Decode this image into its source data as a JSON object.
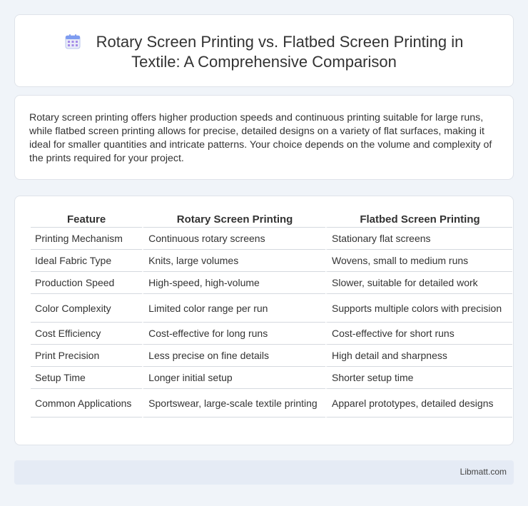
{
  "header": {
    "icon": "calendar-icon",
    "title": "Rotary Screen Printing vs. Flatbed Screen Printing in Textile: A Comprehensive Comparison"
  },
  "intro": {
    "text": "Rotary screen printing offers higher production speeds and continuous printing suitable for large runs, while flatbed screen printing allows for precise, detailed designs on a variety of flat surfaces, making it ideal for smaller quantities and intricate patterns. Your choice depends on the volume and complexity of the prints required for your project."
  },
  "table": {
    "headers": [
      "Feature",
      "Rotary Screen Printing",
      "Flatbed Screen Printing"
    ],
    "rows": [
      [
        "Printing Mechanism",
        "Continuous rotary screens",
        "Stationary flat screens"
      ],
      [
        "Ideal Fabric Type",
        "Knits, large volumes",
        "Wovens, small to medium runs"
      ],
      [
        "Production Speed",
        "High-speed, high-volume",
        "Slower, suitable for detailed work"
      ],
      [
        "Color Complexity",
        "Limited color range per run",
        "Supports multiple colors with precision"
      ],
      [
        "Cost Efficiency",
        "Cost-effective for long runs",
        "Cost-effective for short runs"
      ],
      [
        "Print Precision",
        "Less precise on fine details",
        "High detail and sharpness"
      ],
      [
        "Setup Time",
        "Longer initial setup",
        "Shorter setup time"
      ],
      [
        "Common Applications",
        "Sportswear, large-scale textile printing",
        "Apparel prototypes, detailed designs"
      ]
    ]
  },
  "footer": {
    "site": "Libmatt.com"
  },
  "colors": {
    "background": "#f0f4f9",
    "footer_bg": "#e5ebf5",
    "icon_blue": "#5b8def",
    "icon_purple": "#9b7be0"
  }
}
